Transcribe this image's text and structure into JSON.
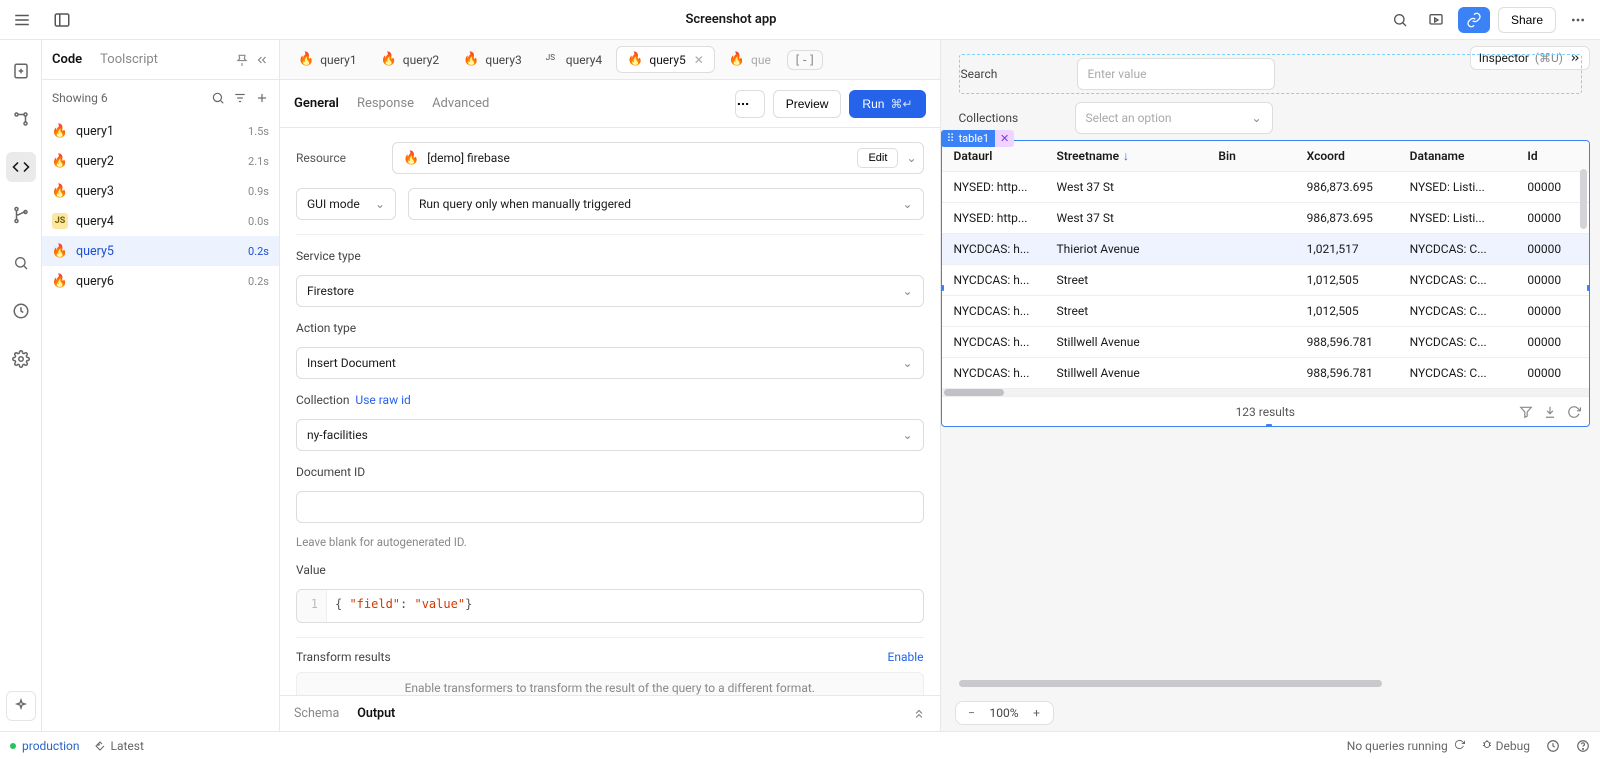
{
  "app_title": "Screenshot app",
  "header": {
    "share_label": "Share"
  },
  "inspector": {
    "label": "Inspector",
    "shortcut": "(⌘U)"
  },
  "sidebar": {
    "tabs": {
      "code": "Code",
      "toolscript": "Toolscript"
    },
    "showing": "Showing 6",
    "items": [
      {
        "type": "fire",
        "name": "query1",
        "time": "1.5s"
      },
      {
        "type": "fire",
        "name": "query2",
        "time": "2.1s"
      },
      {
        "type": "fire",
        "name": "query3",
        "time": "0.9s"
      },
      {
        "type": "js",
        "name": "query4",
        "time": "0.0s"
      },
      {
        "type": "fire",
        "name": "query5",
        "time": "0.2s",
        "active": true
      },
      {
        "type": "fire",
        "name": "query6",
        "time": "0.2s"
      }
    ]
  },
  "editor": {
    "tabs": [
      {
        "name": "query1",
        "icon": "fire"
      },
      {
        "name": "query2",
        "icon": "fire"
      },
      {
        "name": "query3",
        "icon": "fire"
      },
      {
        "name": "query4",
        "icon": "js"
      },
      {
        "name": "query5",
        "icon": "fire",
        "active": true,
        "closable": true
      }
    ],
    "tab_trunc": "que",
    "config_tabs": {
      "general": "General",
      "response": "Response",
      "advanced": "Advanced"
    },
    "buttons": {
      "preview": "Preview",
      "run": "Run",
      "run_shortcut": "⌘↵"
    },
    "resource_label": "Resource",
    "resource_name": "[demo] firebase",
    "edit_label": "Edit",
    "gui_mode": "GUI mode",
    "trigger_mode": "Run query only when manually triggered",
    "service_type_label": "Service type",
    "service_type_value": "Firestore",
    "action_type_label": "Action type",
    "action_type_value": "Insert Document",
    "collection_label": "Collection",
    "use_raw_id": "Use raw id",
    "collection_value": "ny-facilities",
    "doc_id_label": "Document ID",
    "doc_id_hint": "Leave blank for autogenerated ID.",
    "value_label": "Value",
    "value_code_line": "1",
    "value_code_field": "\"field\"",
    "value_code_value": "\"value\"",
    "transform_label": "Transform results",
    "transform_enable": "Enable",
    "transform_hint": "Enable transformers to transform the result of the query to a different format.",
    "bottom_tabs": {
      "schema": "Schema",
      "output": "Output"
    }
  },
  "canvas": {
    "search_label": "Search",
    "search_placeholder": "Enter value",
    "collections_label": "Collections",
    "collections_placeholder": "Select an option",
    "chip_name": "table1"
  },
  "table": {
    "columns": [
      "Dataurl",
      "Streetname",
      "Bin",
      "Xcoord",
      "Dataname",
      "Id"
    ],
    "sort_col_index": 1,
    "rows": [
      {
        "dataurl": "NYSED: http...",
        "street": "West 37 St",
        "bin": "",
        "x": "986,873.695",
        "dn": "NYSED: Listi...",
        "id": "00000"
      },
      {
        "dataurl": "NYSED: http...",
        "street": "West 37 St",
        "bin": "",
        "x": "986,873.695",
        "dn": "NYSED: Listi...",
        "id": "00000"
      },
      {
        "dataurl": "NYCDCAS: h...",
        "street": "Thieriot Avenue",
        "bin": "",
        "x": "1,021,517",
        "dn": "NYCDCAS: C...",
        "id": "00000"
      },
      {
        "dataurl": "NYCDCAS: h...",
        "street": "Street",
        "bin": "",
        "x": "1,012,505",
        "dn": "NYCDCAS: C...",
        "id": "00000"
      },
      {
        "dataurl": "NYCDCAS: h...",
        "street": "Street",
        "bin": "",
        "x": "1,012,505",
        "dn": "NYCDCAS: C...",
        "id": "00000"
      },
      {
        "dataurl": "NYCDCAS: h...",
        "street": "Stillwell Avenue",
        "bin": "",
        "x": "988,596.781",
        "dn": "NYCDCAS: C...",
        "id": "00000"
      },
      {
        "dataurl": "NYCDCAS: h...",
        "street": "Stillwell Avenue",
        "bin": "",
        "x": "988,596.781",
        "dn": "NYCDCAS: C...",
        "id": "00000"
      }
    ],
    "results_text": "123 results"
  },
  "zoom": "100%",
  "status": {
    "env": "production",
    "latest": "Latest",
    "queries": "No queries running",
    "debug": "Debug"
  }
}
